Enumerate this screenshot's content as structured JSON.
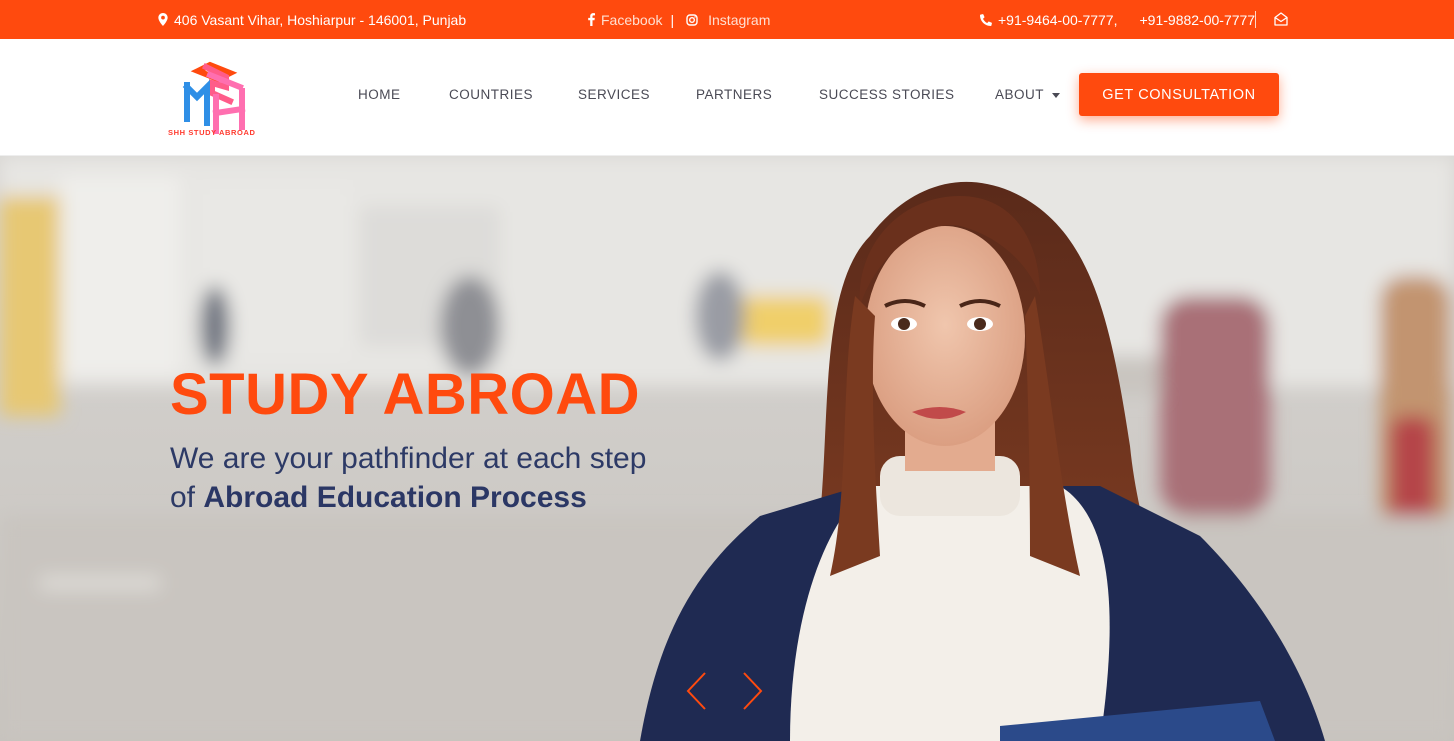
{
  "topbar": {
    "address": "406 Vasant Vihar, Hoshiarpur - 146001, Punjab",
    "facebook": "Facebook",
    "instagram": "Instagram",
    "phone1": "+91-9464-00-7777,",
    "phone2": "+91-9882-00-7777"
  },
  "brand": {
    "name": "SHH STUDY ABROAD"
  },
  "nav": {
    "home": "HOME",
    "countries": "COUNTRIES",
    "services": "SERVICES",
    "partners": "PARTNERS",
    "success": "SUCCESS STORIES",
    "about": "ABOUT"
  },
  "cta": "GET CONSULTATION",
  "hero": {
    "title": "STUDY ABROAD",
    "line1": "We are your pathfinder at each step",
    "line2_prefix": "of ",
    "line2_bold": "Abroad Education Process"
  },
  "colors": {
    "accent": "#ff4a0e",
    "navy": "#2d3a66",
    "nav_text": "#4a4a55"
  }
}
